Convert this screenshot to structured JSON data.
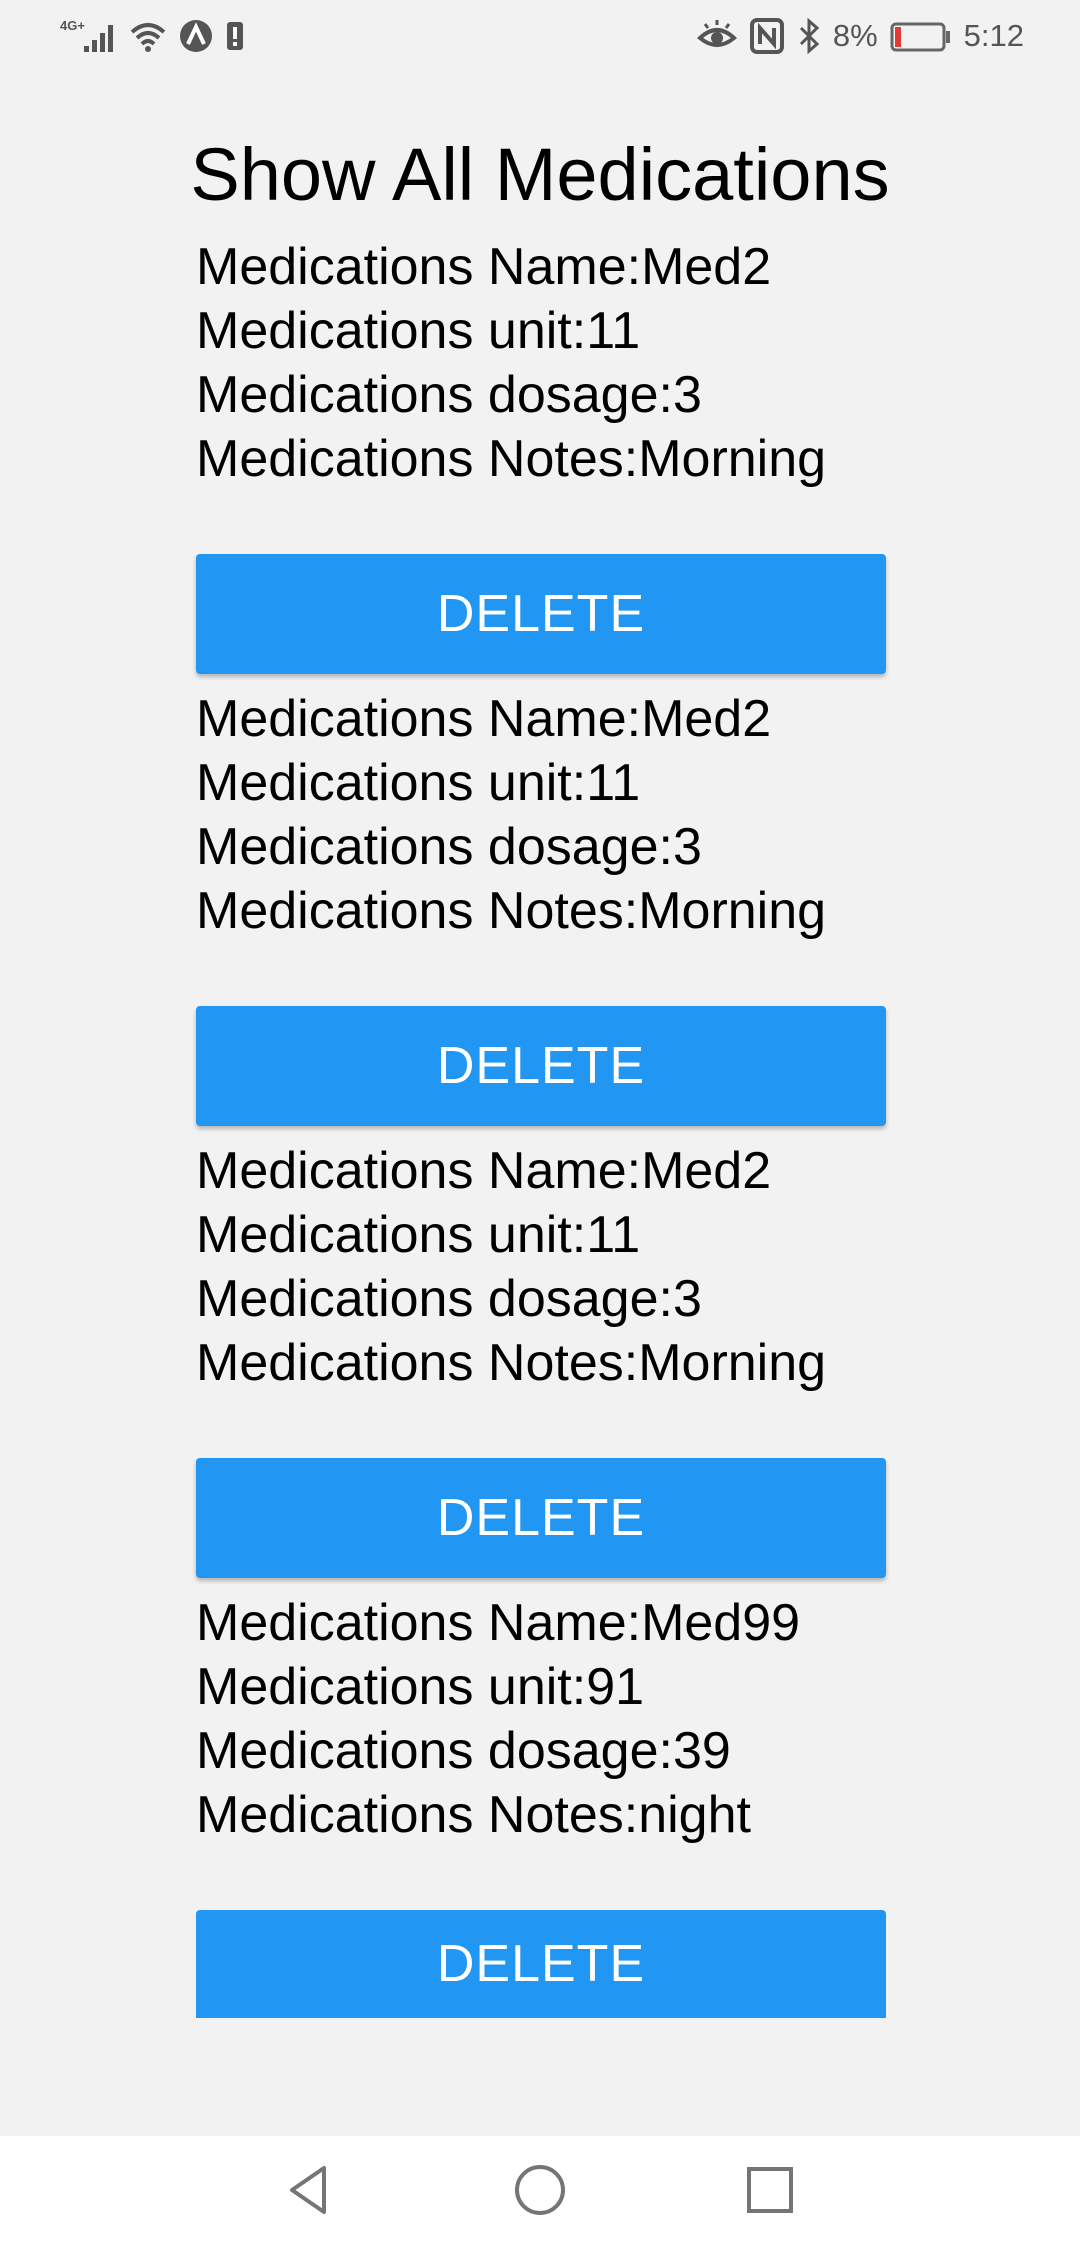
{
  "status_bar": {
    "network": "4G+",
    "battery_percent": "8%",
    "time": "5:12",
    "battery_level": 0.08,
    "battery_color": "#e53935",
    "icons_left": [
      "signal-icon",
      "wifi-icon",
      "app-notification-icon",
      "sim-alert-icon"
    ],
    "icons_right": [
      "eye-comfort-icon",
      "nfc-icon",
      "bluetooth-icon",
      "battery-icon"
    ]
  },
  "page": {
    "title": "Show All Medications"
  },
  "medications": [
    {
      "name": "Medications Name:Med2",
      "unit": "Medications unit:11",
      "dosage": "Medications dosage:3",
      "notes": "Medications Notes:Morning",
      "delete_label": "DELETE"
    },
    {
      "name": "Medications Name:Med2",
      "unit": "Medications unit:11",
      "dosage": "Medications dosage:3",
      "notes": "Medications Notes:Morning",
      "delete_label": "DELETE"
    },
    {
      "name": "Medications Name:Med2",
      "unit": "Medications unit:11",
      "dosage": "Medications dosage:3",
      "notes": "Medications Notes:Morning",
      "delete_label": "DELETE"
    },
    {
      "name": "Medications Name:Med99",
      "unit": "Medications unit:91",
      "dosage": "Medications dosage:39",
      "notes": "Medications Notes:night",
      "delete_label": "DELETE"
    }
  ],
  "colors": {
    "accent": "#2196f3",
    "background": "#f2f2f2",
    "nav_bar": "#ffffff"
  },
  "nav_bar": {
    "buttons": [
      "back-icon",
      "home-icon",
      "recents-icon"
    ]
  }
}
